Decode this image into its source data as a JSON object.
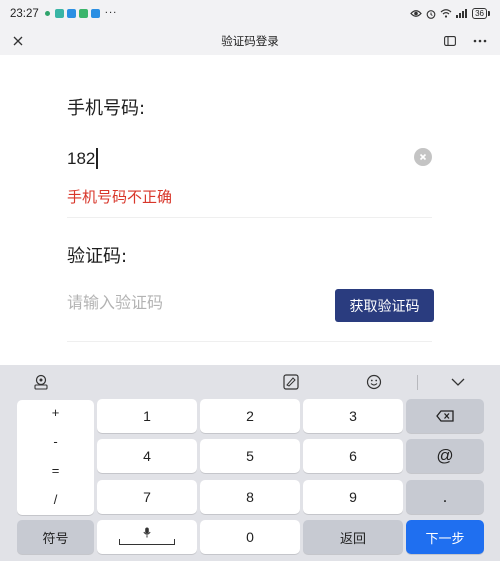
{
  "status_bar": {
    "time": "23:27",
    "more": "···",
    "app_badge_colors": [
      "#39b5a5",
      "#2a8fe3",
      "#3bb56b",
      "#2a8fe3"
    ],
    "battery": "36",
    "icons": [
      "eye-icon",
      "alarm-icon",
      "wifi-icon",
      "signal-icon",
      "battery-icon"
    ]
  },
  "top_bar": {
    "title": "验证码登录",
    "icons": [
      "close-icon",
      "sidebar-icon",
      "more-icon"
    ]
  },
  "form": {
    "phone_label": "手机号码:",
    "phone_value": "182",
    "error": "手机号码不正确",
    "code_label": "验证码:",
    "code_placeholder": "请输入验证码",
    "get_code_button": "获取验证码",
    "colors": {
      "error": "#d8362a",
      "button": "#2a3c7f"
    }
  },
  "keyboard": {
    "toolbar_icons": [
      "keyboard-settings-icon",
      "handwriting-icon",
      "emoji-icon",
      "collapse-icon"
    ],
    "symbols": [
      "+",
      "-",
      "=",
      "/"
    ],
    "digits": [
      "1",
      "2",
      "3",
      "4",
      "5",
      "6",
      "7",
      "8",
      "9",
      "0"
    ],
    "at": "@",
    "dot": ".",
    "symbol_key": "符号",
    "back_key": "返回",
    "next_key": "下一步",
    "colors": {
      "next": "#1f6ff0"
    }
  }
}
